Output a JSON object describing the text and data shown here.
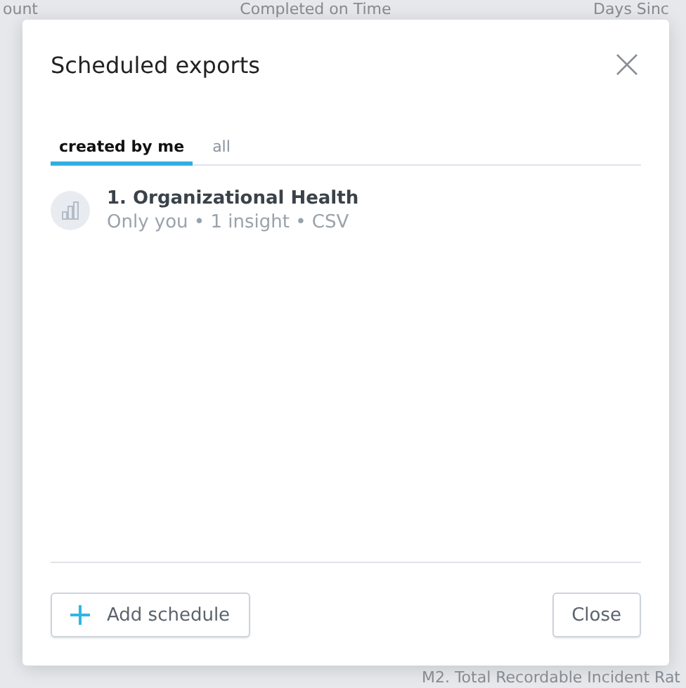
{
  "background": {
    "labels": [
      {
        "text": "ount",
        "kind": "top"
      },
      {
        "text": "Completed on Time",
        "kind": "top"
      },
      {
        "text": "Days Sinc",
        "kind": "top"
      },
      {
        "text": "M2. Total Recordable Incident Rat",
        "kind": "bottom"
      }
    ]
  },
  "dialog": {
    "title": "Scheduled exports",
    "tabs": [
      {
        "label": "created by me",
        "selected": true
      },
      {
        "label": "all",
        "selected": false
      }
    ],
    "schedules": [
      {
        "name": "1. Organizational Health",
        "details": "Only you • 1 insight • CSV"
      }
    ],
    "buttons": [
      {
        "label": "Add schedule",
        "kind": "add"
      },
      {
        "label": "Close",
        "kind": "close"
      }
    ]
  }
}
